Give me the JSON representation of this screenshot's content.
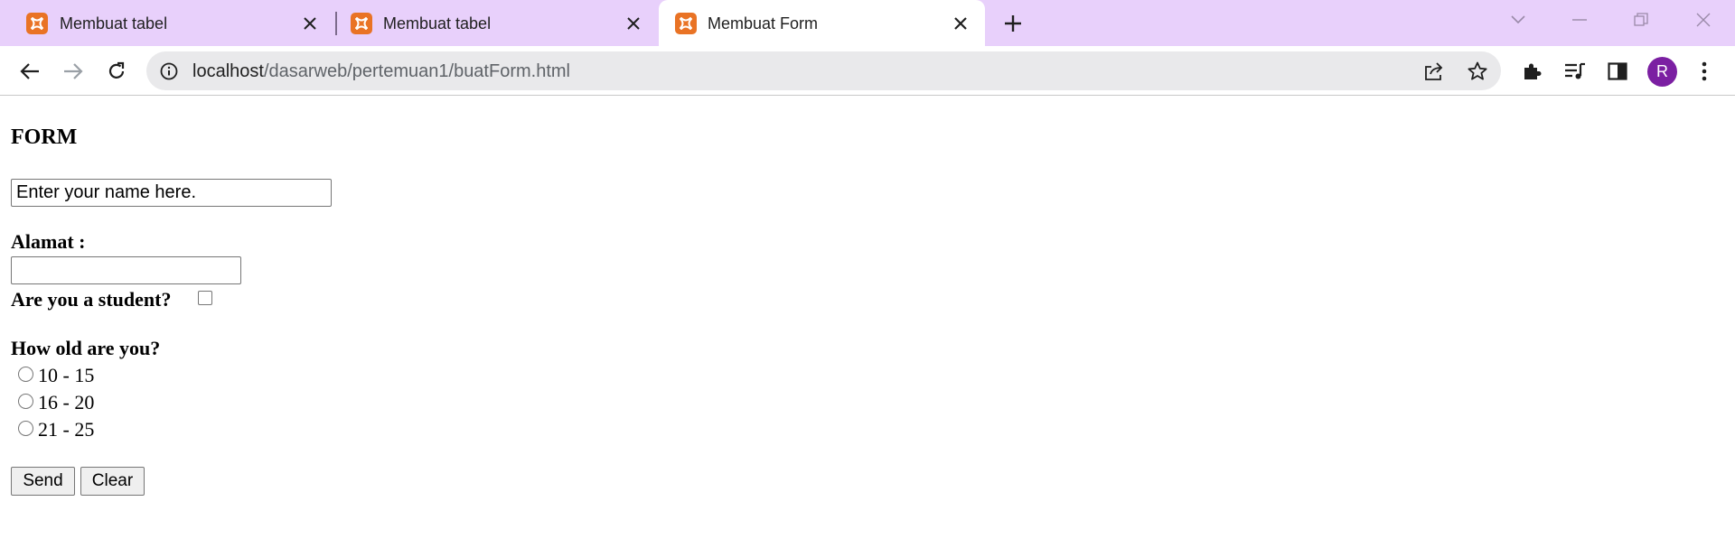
{
  "tabs": [
    {
      "title": "Membuat tabel",
      "active": false,
      "favicon": "xampp-icon"
    },
    {
      "title": "Membuat tabel",
      "active": false,
      "favicon": "xampp-icon"
    },
    {
      "title": "Membuat Form",
      "active": true,
      "favicon": "xampp-icon"
    }
  ],
  "address_bar": {
    "host": "localhost",
    "path": "/dasarweb/pertemuan1/buatForm.html"
  },
  "toolbar": {
    "profile_initial": "R"
  },
  "form": {
    "heading": "FORM",
    "name_value": "Enter your name here.",
    "alamat_label": "Alamat :",
    "alamat_value": "",
    "student_label": "Are you a student?",
    "student_checked": false,
    "age_label": "How old are you?",
    "age_options": [
      "10 - 15",
      "16 - 20",
      "21 - 25"
    ],
    "send_label": "Send",
    "clear_label": "Clear"
  },
  "colors": {
    "tabstrip_bg": "#e8d0fb",
    "favicon": "#e97325",
    "avatar": "#7b1fa2",
    "omnibox_bg": "#e9e9eb"
  }
}
